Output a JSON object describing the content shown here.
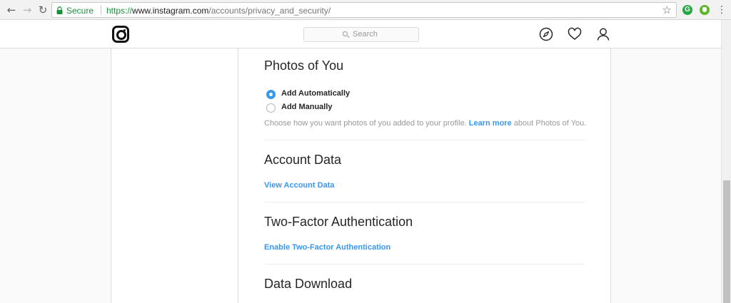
{
  "browser": {
    "secure_label": "Secure",
    "url_scheme": "https://",
    "url_host": "www.instagram.com",
    "url_path": "/accounts/privacy_and_security/",
    "accent_secure": "#1e8e3e"
  },
  "header": {
    "search_placeholder": "Search",
    "icons": [
      "instagram-logo-icon",
      "compass-icon",
      "heart-icon",
      "person-icon"
    ]
  },
  "photos_of_you": {
    "title": "Photos of You",
    "options": [
      {
        "label": "Add Automatically",
        "checked": true
      },
      {
        "label": "Add Manually",
        "checked": false
      }
    ],
    "help_prefix": "Choose how you want photos of you added to your profile. ",
    "help_link": "Learn more",
    "help_suffix": " about Photos of You."
  },
  "account_data": {
    "title": "Account Data",
    "link": "View Account Data"
  },
  "two_factor": {
    "title": "Two-Factor Authentication",
    "link": "Enable Two-Factor Authentication"
  },
  "data_download": {
    "title": "Data Download"
  },
  "colors": {
    "link_blue": "#3897f0",
    "border": "#dbdbdb",
    "text": "#262626",
    "muted": "#999999"
  }
}
